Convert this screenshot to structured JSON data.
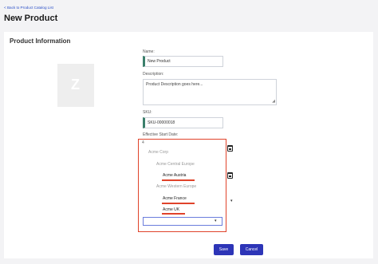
{
  "nav": {
    "back_label": "< Back to Product Catalog List"
  },
  "page": {
    "title": "New Product"
  },
  "section": {
    "title": "Product Information"
  },
  "image_placeholder": {
    "glyph": "Z"
  },
  "form": {
    "name_label": "Name:",
    "name_value": "New Product",
    "description_label": "Description:",
    "description_value": "Product Description goes here...",
    "sku_label": "SKU:",
    "sku_value": "SKU-00000018",
    "start_date_label": "Effective Start Date:",
    "start_date_stub": "4"
  },
  "dropdown": {
    "items": [
      "Acme Corp",
      "Acme Central Europe",
      "Acme Austria",
      "Acme Western Europe",
      "Acme France",
      "Acme UK"
    ],
    "selected": [
      "Acme Austria",
      "Acme France",
      "Acme UK"
    ],
    "select_placeholder": ""
  },
  "actions": {
    "save_label": "Save",
    "cancel_label": "Cancel"
  },
  "colors": {
    "primary": "#2d35b7",
    "highlight": "#e0432b",
    "accent": "#3b7f6b"
  }
}
